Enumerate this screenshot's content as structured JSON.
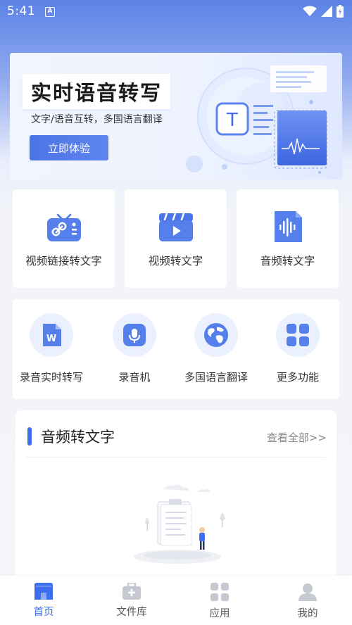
{
  "status_bar": {
    "time": "5:41",
    "indicator": "A"
  },
  "banner": {
    "title": "实时语音转写",
    "subtitle": "文字/语音互转，多国语言翻译",
    "button_label": "立即体验",
    "icon_text": "T"
  },
  "features": [
    {
      "label": "视频链接转文字",
      "icon": "video-link-icon"
    },
    {
      "label": "视频转文字",
      "icon": "video-clapper-icon"
    },
    {
      "label": "音频转文字",
      "icon": "audio-file-icon"
    }
  ],
  "tools": [
    {
      "label": "录音实时转写",
      "icon": "word-doc-icon"
    },
    {
      "label": "录音机",
      "icon": "microphone-icon"
    },
    {
      "label": "多国语言翻译",
      "icon": "globe-icon"
    },
    {
      "label": "更多功能",
      "icon": "grid-icon"
    }
  ],
  "section": {
    "title": "音频转文字",
    "link": "查看全部>>"
  },
  "bottom_nav": [
    {
      "label": "首页",
      "icon": "home-icon",
      "active": true
    },
    {
      "label": "文件库",
      "icon": "briefcase-icon",
      "active": false
    },
    {
      "label": "应用",
      "icon": "apps-icon",
      "active": false
    },
    {
      "label": "我的",
      "icon": "user-icon",
      "active": false
    }
  ],
  "colors": {
    "accent": "#3d6ef0",
    "header_gradient_top": "#5b82e6",
    "background": "#f3f5fa"
  }
}
